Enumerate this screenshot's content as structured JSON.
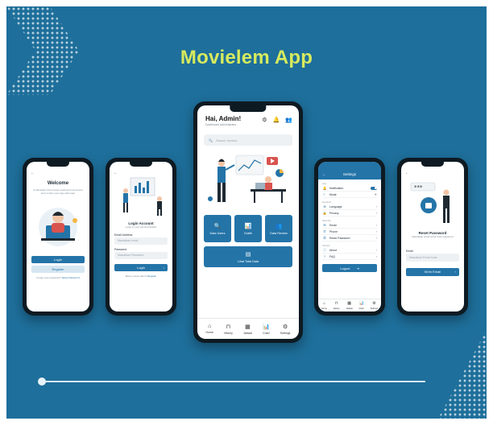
{
  "title": "Movielem App",
  "phones": {
    "welcome": {
      "back": "←",
      "heading": "Welcome",
      "desc": "At Movielem find movies quick and convenient and monitor your logs with ease",
      "login": "Login",
      "register": "Register",
      "forgot_prefix": "Forgot your password?",
      "forgot_link": "Reset Password"
    },
    "login": {
      "back": "←",
      "heading": "Login Account",
      "desc": "Login to your account details",
      "email_label": "Email Address",
      "email_placeholder": "Masukkan email",
      "password_label": "Password",
      "password_placeholder": "Masukkan Password",
      "submit": "Login",
      "footer_prefix": "Belum punya akun?",
      "footer_link": "Register"
    },
    "home": {
      "greeting": "Hai, Admin!",
      "subtitle": "Dashboard Administrator",
      "search_placeholder": "Search movies",
      "tiles": [
        "Data Users",
        "Grafik",
        "Data Review"
      ],
      "wide_tile": "Lihat Total Data",
      "nav": [
        "Home",
        "History",
        "Jadwal",
        "Chart",
        "Settings"
      ]
    },
    "settings": {
      "back": "←",
      "heading": "Settings",
      "section_app": "App",
      "rows_app": [
        "Notification",
        "Mode"
      ],
      "section_general": "General",
      "rows_general": [
        "Language",
        "Privacy"
      ],
      "section_security": "Security",
      "rows_security": [
        "Email",
        "Phone",
        "Reset Password"
      ],
      "section_about": "Version",
      "rows_about": [
        "About",
        "FAQ"
      ],
      "logout": "Logout",
      "nav": [
        "Home",
        "History",
        "Jadwal",
        "Chart",
        "Settings"
      ]
    },
    "reset": {
      "back": "←",
      "heading": "Reset Password",
      "desc": "Masukkan email untuk reset password",
      "email_label": "Email",
      "email_placeholder": "Masukkan Email Anda",
      "submit": "Kirim Email"
    }
  },
  "colors": {
    "background": "#1e6f9b",
    "title": "#d6ea5e",
    "primary": "#2474a8"
  }
}
